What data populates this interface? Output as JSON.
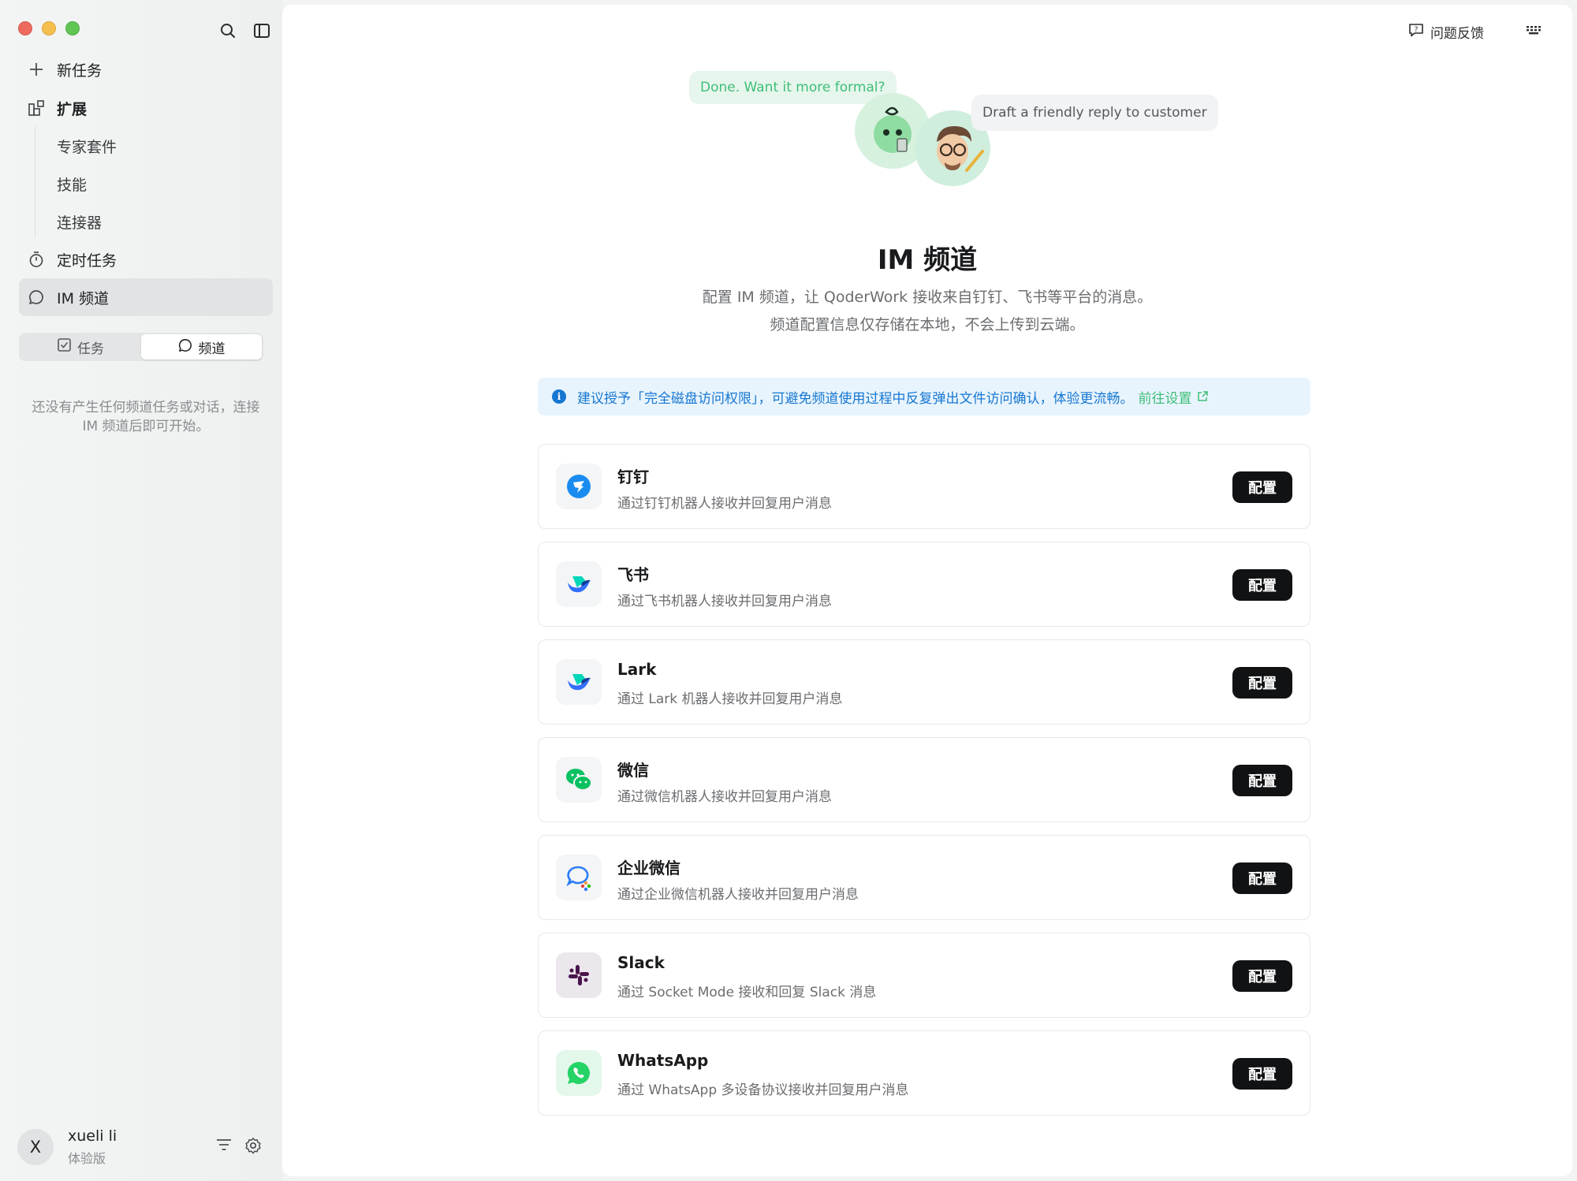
{
  "window": {
    "controls": [
      "close",
      "minimize",
      "zoom"
    ]
  },
  "sidebar": {
    "top_icons": [
      "search-icon",
      "sidebar-toggle-icon"
    ],
    "items": [
      {
        "label": "新任务",
        "icon": "plus-icon"
      },
      {
        "label": "扩展",
        "icon": "extension-icon"
      },
      {
        "label": "专家套件"
      },
      {
        "label": "技能"
      },
      {
        "label": "连接器"
      },
      {
        "label": "定时任务",
        "icon": "timer-icon"
      },
      {
        "label": "IM 频道",
        "icon": "chat-bubble-icon"
      }
    ],
    "segment": {
      "tasks_label": "任务",
      "channels_label": "频道",
      "selected": "频道"
    },
    "empty_note": "还没有产生任何频道任务或对话，连接 IM 频道后即可开始。",
    "user": {
      "initial": "X",
      "name": "xueli li",
      "plan": "体验版"
    }
  },
  "header": {
    "feedback_label": "问题反馈"
  },
  "hero": {
    "bubble_left": "Done. Want it more formal?",
    "bubble_right": "Draft a friendly reply to customer"
  },
  "page": {
    "title": "IM 频道",
    "desc_line1": "配置 IM 频道，让 QoderWork 接收来自钉钉、飞书等平台的消息。",
    "desc_line2": "频道配置信息仅存储在本地，不会上传到云端。"
  },
  "notice": {
    "text": "建议授予「完全磁盘访问权限」，可避免频道使用过程中反复弹出文件访问确认，体验更流畅。",
    "link": "前往设置"
  },
  "configure_label": "配置",
  "channels": [
    {
      "name": "钉钉",
      "desc": "通过钉钉机器人接收并回复用户消息",
      "icon": "dingtalk-icon",
      "color": "#1a8cf0"
    },
    {
      "name": "飞书",
      "desc": "通过飞书机器人接收并回复用户消息",
      "icon": "feishu-icon",
      "color": "#3370ff"
    },
    {
      "name": "Lark",
      "desc": "通过 Lark 机器人接收并回复用户消息",
      "icon": "lark-icon",
      "color": "#3370ff"
    },
    {
      "name": "微信",
      "desc": "通过微信机器人接收并回复用户消息",
      "icon": "wechat-icon",
      "color": "#07c160"
    },
    {
      "name": "企业微信",
      "desc": "通过企业微信机器人接收并回复用户消息",
      "icon": "wecom-icon",
      "color": "#2b7cf6"
    },
    {
      "name": "Slack",
      "desc": "通过 Socket Mode 接收和回复 Slack 消息",
      "icon": "slack-icon",
      "color": "#4a154b"
    },
    {
      "name": "WhatsApp",
      "desc": "通过 WhatsApp 多设备协议接收并回复用户消息",
      "icon": "whatsapp-icon",
      "color": "#25d366"
    }
  ]
}
